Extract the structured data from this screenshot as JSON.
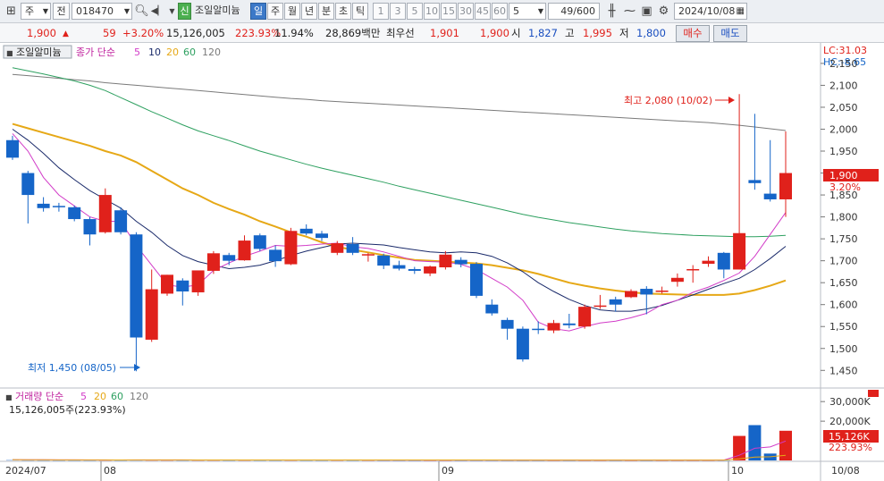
{
  "toolbar": {
    "market": "주",
    "period_type": "전",
    "code": "018470",
    "shin_badge": "신",
    "name": "조일알미늄",
    "tabs": [
      "일",
      "주",
      "월",
      "년",
      "분",
      "초",
      "틱"
    ],
    "active_tab": "일",
    "intervals": [
      "1",
      "3",
      "5",
      "10",
      "15",
      "30",
      "45",
      "60"
    ],
    "interval_select": "5",
    "count": "49/600",
    "date": "2024/10/08"
  },
  "infobar": {
    "price": "1,900",
    "arrow": "▲",
    "change": "59",
    "change_pct": "+3.20%",
    "volume": "15,126,005",
    "vol_ratio": "223.93%",
    "turnover": "11.94%",
    "amount": "28,869백만",
    "best_label": "최우선",
    "best_ask": "1,901",
    "best_bid": "1,900",
    "open_label": "시",
    "open": "1,827",
    "high_label": "고",
    "high": "1,995",
    "low_label": "저",
    "low": "1,800",
    "buy_label": "매수",
    "sell_label": "매도"
  },
  "legend": {
    "title": "조일알미늄",
    "ma_label": "종가 단순",
    "ma_periods": [
      "5",
      "10",
      "20",
      "60",
      "120"
    ],
    "vol_label": "거래량 단순",
    "vol_periods": [
      "5",
      "20",
      "60",
      "120"
    ],
    "vol_value": "15,126,005주(223.93%)"
  },
  "right_axis": {
    "lc": "LC:31.03",
    "hc": "HC:-8.65",
    "price_ticks": [
      "2,150",
      "2,100",
      "2,050",
      "2,000",
      "1,950",
      "1,900",
      "1,850",
      "1,800",
      "1,750",
      "1,700",
      "1,650",
      "1,600",
      "1,550",
      "1,500",
      "1,450"
    ],
    "current_price": "1,900",
    "current_pct": "3.20%",
    "vol_ticks": [
      "30,000K",
      "20,000K"
    ],
    "current_vol": "15,126K",
    "current_vol_pct": "223.93%"
  },
  "annotations": {
    "high_note": "최고 2,080 (10/02)",
    "low_note": "최저 1,450 (08/05)"
  },
  "x_labels": [
    "2024/07",
    "08",
    "09",
    "10",
    "10/08"
  ],
  "colors": {
    "up": "#e0211b",
    "down": "#1565c8",
    "ma5": "#d23cc8",
    "ma10": "#1a2a6a",
    "ma20": "#e6a816",
    "ma60": "#2ea060",
    "ma120": "#7a7a7a"
  },
  "chart_data": {
    "type": "candlestick",
    "candles": [
      {
        "o": 1975,
        "h": 1985,
        "c": 1935,
        "l": 1930
      },
      {
        "o": 1900,
        "h": 1905,
        "c": 1850,
        "l": 1785
      },
      {
        "o": 1830,
        "h": 1845,
        "c": 1820,
        "l": 1812
      },
      {
        "o": 1825,
        "h": 1832,
        "c": 1823,
        "l": 1812
      },
      {
        "o": 1822,
        "h": 1826,
        "c": 1795,
        "l": 1790
      },
      {
        "o": 1795,
        "h": 1800,
        "c": 1760,
        "l": 1735
      },
      {
        "o": 1765,
        "h": 1865,
        "c": 1850,
        "l": 1762
      },
      {
        "o": 1815,
        "h": 1822,
        "c": 1765,
        "l": 1760
      },
      {
        "o": 1760,
        "h": 1765,
        "c": 1525,
        "l": 1448
      },
      {
        "o": 1520,
        "h": 1680,
        "c": 1635,
        "l": 1515
      },
      {
        "o": 1625,
        "h": 1668,
        "c": 1668,
        "l": 1620
      },
      {
        "o": 1655,
        "h": 1660,
        "c": 1630,
        "l": 1598
      },
      {
        "o": 1628,
        "h": 1676,
        "c": 1678,
        "l": 1620
      },
      {
        "o": 1677,
        "h": 1722,
        "c": 1717,
        "l": 1670
      },
      {
        "o": 1713,
        "h": 1718,
        "c": 1700,
        "l": 1690
      },
      {
        "o": 1701,
        "h": 1758,
        "c": 1746,
        "l": 1700
      },
      {
        "o": 1758,
        "h": 1762,
        "c": 1727,
        "l": 1722
      },
      {
        "o": 1725,
        "h": 1735,
        "c": 1699,
        "l": 1686
      },
      {
        "o": 1692,
        "h": 1775,
        "c": 1768,
        "l": 1690
      },
      {
        "o": 1773,
        "h": 1783,
        "c": 1762,
        "l": 1758
      },
      {
        "o": 1762,
        "h": 1768,
        "c": 1752,
        "l": 1745
      },
      {
        "o": 1718,
        "h": 1745,
        "c": 1740,
        "l": 1713
      },
      {
        "o": 1738,
        "h": 1754,
        "c": 1718,
        "l": 1713
      },
      {
        "o": 1712,
        "h": 1718,
        "c": 1715,
        "l": 1698
      },
      {
        "o": 1712,
        "h": 1716,
        "c": 1689,
        "l": 1681
      },
      {
        "o": 1690,
        "h": 1700,
        "c": 1682,
        "l": 1678
      },
      {
        "o": 1681,
        "h": 1686,
        "c": 1677,
        "l": 1670
      },
      {
        "o": 1671,
        "h": 1689,
        "c": 1687,
        "l": 1665
      },
      {
        "o": 1685,
        "h": 1722,
        "c": 1714,
        "l": 1680
      },
      {
        "o": 1702,
        "h": 1708,
        "c": 1692,
        "l": 1685
      },
      {
        "o": 1693,
        "h": 1697,
        "c": 1620,
        "l": 1615
      },
      {
        "o": 1600,
        "h": 1612,
        "c": 1580,
        "l": 1575
      },
      {
        "o": 1565,
        "h": 1570,
        "c": 1545,
        "l": 1520
      },
      {
        "o": 1545,
        "h": 1550,
        "c": 1475,
        "l": 1470
      },
      {
        "o": 1545,
        "h": 1562,
        "c": 1543,
        "l": 1533
      },
      {
        "o": 1541,
        "h": 1565,
        "c": 1558,
        "l": 1535
      },
      {
        "o": 1557,
        "h": 1579,
        "c": 1553,
        "l": 1546
      },
      {
        "o": 1550,
        "h": 1600,
        "c": 1595,
        "l": 1545
      },
      {
        "o": 1597,
        "h": 1622,
        "c": 1598,
        "l": 1590
      },
      {
        "o": 1612,
        "h": 1618,
        "c": 1600,
        "l": 1584
      },
      {
        "o": 1617,
        "h": 1635,
        "c": 1631,
        "l": 1615
      },
      {
        "o": 1636,
        "h": 1642,
        "c": 1623,
        "l": 1578
      },
      {
        "o": 1630,
        "h": 1641,
        "c": 1632,
        "l": 1625
      },
      {
        "o": 1652,
        "h": 1671,
        "c": 1661,
        "l": 1641
      },
      {
        "o": 1680,
        "h": 1690,
        "c": 1681,
        "l": 1650
      },
      {
        "o": 1693,
        "h": 1710,
        "c": 1700,
        "l": 1686
      },
      {
        "o": 1718,
        "h": 1720,
        "c": 1680,
        "l": 1660
      },
      {
        "o": 1680,
        "h": 2080,
        "c": 1763,
        "l": 1680
      },
      {
        "o": 1884,
        "h": 2035,
        "c": 1877,
        "l": 1862
      },
      {
        "o": 1853,
        "h": 1975,
        "c": 1840,
        "l": 1835
      },
      {
        "o": 1840,
        "h": 1995,
        "c": 1900,
        "l": 1800
      }
    ],
    "volumes": [
      420,
      260,
      230,
      210,
      200,
      220,
      240,
      210,
      300,
      260,
      240,
      230,
      220,
      230,
      210,
      230,
      220,
      210,
      230,
      220,
      210,
      220,
      200,
      200,
      190,
      190,
      180,
      180,
      190,
      185,
      200,
      190,
      200,
      180,
      170,
      180,
      175,
      180,
      170,
      175,
      170,
      165,
      175,
      180,
      175,
      190,
      230,
      12500,
      18000,
      3500,
      15126
    ],
    "ma5": [
      1990,
      1950,
      1890,
      1850,
      1825,
      1800,
      1790,
      1790,
      1735,
      1690,
      1645,
      1640,
      1645,
      1678,
      1695,
      1710,
      1722,
      1735,
      1733,
      1735,
      1738,
      1740,
      1732,
      1728,
      1720,
      1710,
      1700,
      1698,
      1697,
      1692,
      1680,
      1660,
      1640,
      1610,
      1560,
      1545,
      1540,
      1550,
      1558,
      1562,
      1570,
      1580,
      1600,
      1610,
      1628,
      1640,
      1655,
      1672,
      1710,
      1760,
      1810
    ],
    "ma10": [
      2000,
      1975,
      1945,
      1912,
      1885,
      1860,
      1840,
      1820,
      1790,
      1765,
      1735,
      1712,
      1698,
      1690,
      1682,
      1685,
      1690,
      1700,
      1712,
      1722,
      1730,
      1738,
      1740,
      1738,
      1736,
      1730,
      1725,
      1720,
      1718,
      1720,
      1718,
      1710,
      1695,
      1675,
      1650,
      1630,
      1612,
      1598,
      1588,
      1585,
      1585,
      1590,
      1598,
      1610,
      1622,
      1635,
      1648,
      1660,
      1680,
      1705,
      1733
    ],
    "ma20": [
      2012,
      2002,
      1992,
      1982,
      1972,
      1962,
      1950,
      1940,
      1925,
      1905,
      1885,
      1865,
      1850,
      1832,
      1818,
      1805,
      1790,
      1778,
      1765,
      1755,
      1742,
      1732,
      1725,
      1719,
      1713,
      1707,
      1702,
      1700,
      1698,
      1696,
      1694,
      1690,
      1684,
      1678,
      1670,
      1660,
      1650,
      1643,
      1637,
      1632,
      1628,
      1625,
      1624,
      1623,
      1622,
      1622,
      1622,
      1625,
      1633,
      1643,
      1655
    ],
    "ma60": [
      2140,
      2133,
      2126,
      2118,
      2110,
      2100,
      2088,
      2072,
      2056,
      2040,
      2025,
      2010,
      1996,
      1985,
      1974,
      1962,
      1950,
      1940,
      1930,
      1920,
      1911,
      1903,
      1895,
      1887,
      1879,
      1870,
      1862,
      1854,
      1846,
      1838,
      1830,
      1822,
      1814,
      1806,
      1799,
      1793,
      1787,
      1782,
      1777,
      1772,
      1768,
      1765,
      1762,
      1760,
      1758,
      1757,
      1756,
      1755,
      1755,
      1756,
      1758
    ],
    "ma120": [
      2125,
      2122,
      2119,
      2116,
      2113,
      2110,
      2106,
      2103,
      2100,
      2097,
      2094,
      2091,
      2088,
      2085,
      2082,
      2079,
      2076,
      2073,
      2070,
      2068,
      2065,
      2063,
      2061,
      2059,
      2057,
      2055,
      2053,
      2051,
      2049,
      2047,
      2045,
      2043,
      2041,
      2039,
      2037,
      2035,
      2033,
      2031,
      2029,
      2027,
      2025,
      2023,
      2021,
      2019,
      2017,
      2015,
      2012,
      2009,
      2005,
      2001,
      1997
    ]
  }
}
